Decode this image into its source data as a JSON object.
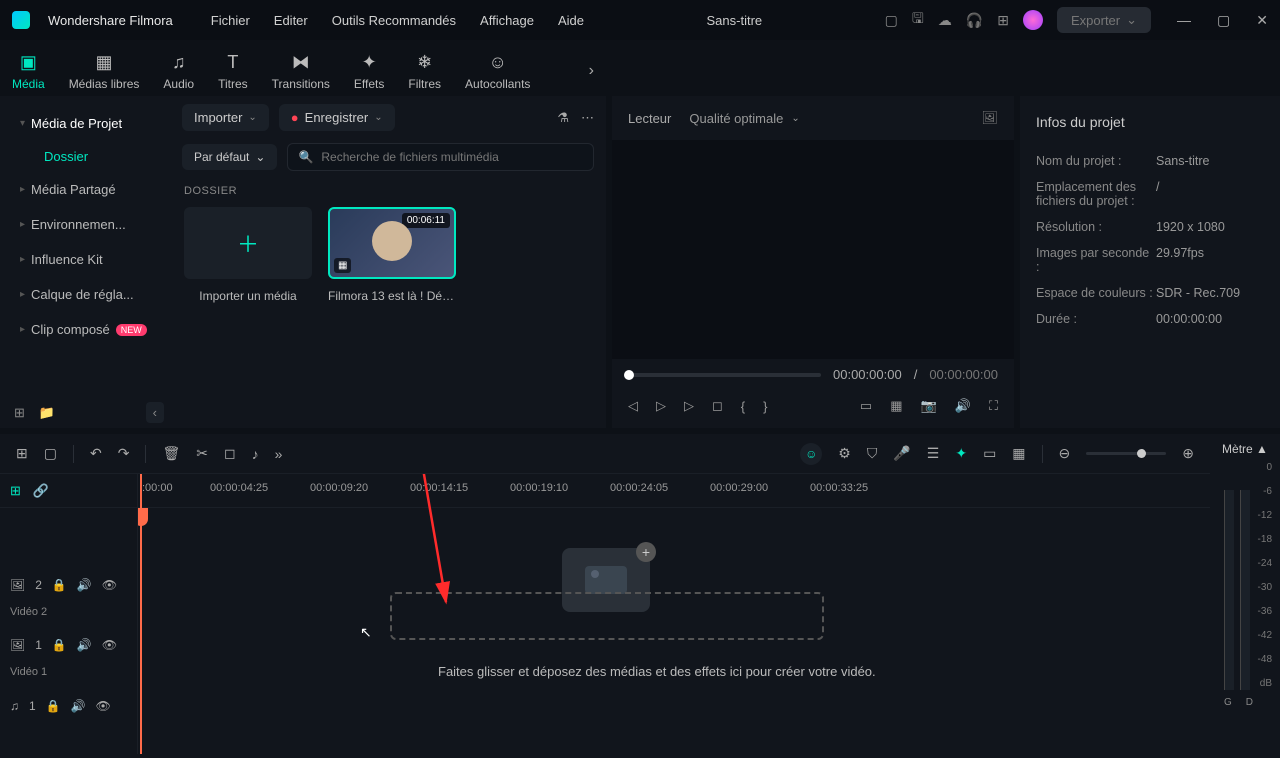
{
  "titlebar": {
    "appname": "Wondershare Filmora",
    "menus": [
      "Fichier",
      "Editer",
      "Outils Recommandés",
      "Affichage",
      "Aide"
    ],
    "project_title": "Sans-titre",
    "export_label": "Exporter"
  },
  "tabs": {
    "items": [
      {
        "label": "Média",
        "icon": "▣"
      },
      {
        "label": "Médias libres",
        "icon": "▦"
      },
      {
        "label": "Audio",
        "icon": "♫"
      },
      {
        "label": "Titres",
        "icon": "T"
      },
      {
        "label": "Transitions",
        "icon": "⧓"
      },
      {
        "label": "Effets",
        "icon": "✦"
      },
      {
        "label": "Filtres",
        "icon": "❄"
      },
      {
        "label": "Autocollants",
        "icon": "☺"
      }
    ],
    "active_index": 0
  },
  "sidebar": {
    "items": [
      {
        "label": "Média de Projet"
      },
      {
        "label": "Média Partagé"
      },
      {
        "label": "Environnemen..."
      },
      {
        "label": "Influence Kit"
      },
      {
        "label": "Calque de régla..."
      },
      {
        "label": "Clip composé"
      }
    ],
    "sub_item": "Dossier"
  },
  "mid": {
    "import_btn": "Importer",
    "record_btn": "Enregistrer",
    "default_select": "Par défaut",
    "search_placeholder": "Recherche de fichiers multimédia",
    "dossier_label": "DOSSIER",
    "import_tile_label": "Importer un média",
    "media_item": {
      "title": "Filmora 13 est là ! Déc...",
      "duration": "00:06:11"
    }
  },
  "preview": {
    "player_label": "Lecteur",
    "quality_label": "Qualité optimale",
    "time_current": "00:00:00:00",
    "time_sep": "/",
    "time_total": "00:00:00:00"
  },
  "info": {
    "title": "Infos du projet",
    "rows": [
      {
        "k": "Nom du projet :",
        "v": "Sans-titre"
      },
      {
        "k": "Emplacement des fichiers du projet :",
        "v": "/"
      },
      {
        "k": "Résolution :",
        "v": "1920 x 1080"
      },
      {
        "k": "Images par seconde :",
        "v": "29.97fps"
      },
      {
        "k": "Espace de couleurs :",
        "v": "SDR - Rec.709"
      },
      {
        "k": "Durée :",
        "v": "00:00:00:00"
      }
    ]
  },
  "timeline": {
    "meter_label": "Mètre ▲",
    "meter_ticks": [
      "0",
      "-6",
      "-12",
      "-18",
      "-24",
      "-30",
      "-36",
      "-42",
      "-48",
      "dB"
    ],
    "ruler_ticks": [
      ":00:00",
      "00:00:04:25",
      "00:00:09:20",
      "00:00:14:15",
      "00:00:19:10",
      "00:00:24:05",
      "00:00:29:00",
      "00:00:33:25"
    ],
    "drop_text": "Faites glisser et déposez des médias et des effets ici pour créer votre vidéo.",
    "tracks": [
      {
        "icon": "🖼",
        "num": "2",
        "name": "Vidéo 2"
      },
      {
        "icon": "🖼",
        "num": "1",
        "name": "Vidéo 1"
      },
      {
        "icon": "♫",
        "num": "1",
        "name": ""
      }
    ],
    "gd_left": "G",
    "gd_right": "D"
  }
}
